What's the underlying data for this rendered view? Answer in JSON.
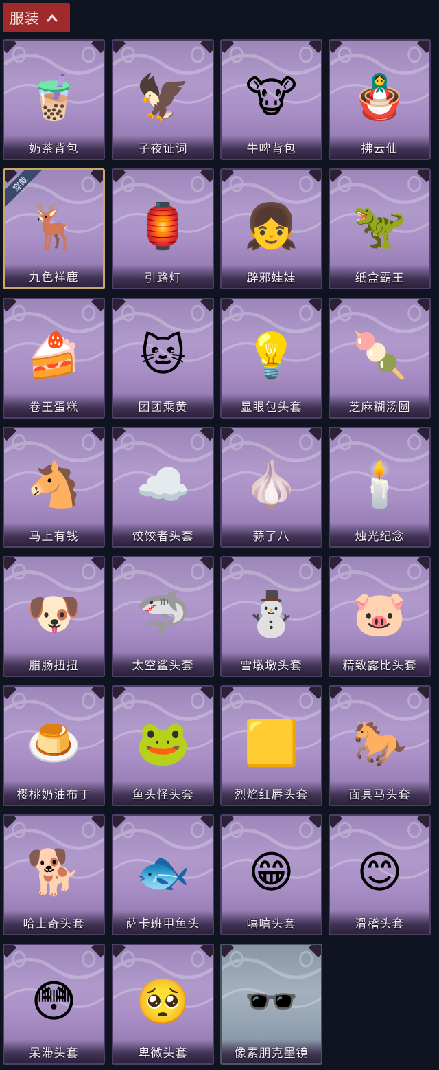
{
  "header": {
    "title": "服装"
  },
  "items": [
    {
      "label": "奶茶背包",
      "icon": "milk-tea-icon",
      "glyph": "🧋",
      "equipped": false,
      "style": "purple"
    },
    {
      "label": "子夜证词",
      "icon": "plague-doctor-icon",
      "glyph": "🦅",
      "equipped": false,
      "style": "purple"
    },
    {
      "label": "牛啤背包",
      "icon": "beer-barrel-icon",
      "glyph": "🐮",
      "equipped": false,
      "style": "purple"
    },
    {
      "label": "拂云仙",
      "icon": "cloud-fairy-charm-icon",
      "glyph": "🪆",
      "equipped": false,
      "style": "purple"
    },
    {
      "label": "九色祥鹿",
      "icon": "deer-charm-icon",
      "glyph": "🦌",
      "equipped": true,
      "badge": "穿戴",
      "style": "purple"
    },
    {
      "label": "引路灯",
      "icon": "lantern-icon",
      "glyph": "🏮",
      "equipped": false,
      "style": "purple"
    },
    {
      "label": "辟邪娃娃",
      "icon": "doll-head-icon",
      "glyph": "👧",
      "equipped": false,
      "style": "purple"
    },
    {
      "label": "纸盒霸王",
      "icon": "box-dinosaur-icon",
      "glyph": "🦖",
      "equipped": false,
      "style": "purple"
    },
    {
      "label": "卷王蛋糕",
      "icon": "roll-cake-icon",
      "glyph": "🍰",
      "equipped": false,
      "style": "purple"
    },
    {
      "label": "团团乘黄",
      "icon": "fluffy-cat-head-icon",
      "glyph": "🐱",
      "equipped": false,
      "style": "purple"
    },
    {
      "label": "显眼包头套",
      "icon": "lightbulb-head-icon",
      "glyph": "💡",
      "equipped": false,
      "style": "purple"
    },
    {
      "label": "芝麻糊汤圆",
      "icon": "dumpling-head-icon",
      "glyph": "🍡",
      "equipped": false,
      "style": "purple"
    },
    {
      "label": "马上有钱",
      "icon": "horse-head-icon",
      "glyph": "🐴",
      "equipped": false,
      "style": "purple"
    },
    {
      "label": "饺饺者头套",
      "icon": "cloud-head-icon",
      "glyph": "☁️",
      "equipped": false,
      "style": "purple"
    },
    {
      "label": "蒜了八",
      "icon": "garlic-head-icon",
      "glyph": "🧄",
      "equipped": false,
      "style": "purple"
    },
    {
      "label": "烛光纪念",
      "icon": "candle-head-icon",
      "glyph": "🕯️",
      "equipped": false,
      "style": "purple"
    },
    {
      "label": "腊肠扭扭",
      "icon": "dachshund-head-icon",
      "glyph": "🐶",
      "equipped": false,
      "style": "purple"
    },
    {
      "label": "太空鲨头套",
      "icon": "shark-head-icon",
      "glyph": "🦈",
      "equipped": false,
      "style": "purple"
    },
    {
      "label": "雪墩墩头套",
      "icon": "snowman-head-icon",
      "glyph": "⛄",
      "equipped": false,
      "style": "purple"
    },
    {
      "label": "精致露比头套",
      "icon": "pink-beaver-head-icon",
      "glyph": "🐷",
      "equipped": false,
      "style": "purple"
    },
    {
      "label": "樱桃奶油布丁",
      "icon": "pudding-head-icon",
      "glyph": "🍮",
      "equipped": false,
      "style": "purple"
    },
    {
      "label": "鱼头怪头套",
      "icon": "fish-head-icon",
      "glyph": "🐸",
      "equipped": false,
      "style": "purple"
    },
    {
      "label": "烈焰红唇头套",
      "icon": "pikachu-mask-icon",
      "glyph": "🟨",
      "equipped": false,
      "style": "purple"
    },
    {
      "label": "面具马头套",
      "icon": "horse-mask-icon",
      "glyph": "🐎",
      "equipped": false,
      "style": "purple"
    },
    {
      "label": "哈士奇头套",
      "icon": "husky-head-icon",
      "glyph": "🐕",
      "equipped": false,
      "style": "purple"
    },
    {
      "label": "萨卡班甲鱼头",
      "icon": "sacabambaspis-head-icon",
      "glyph": "🐟",
      "equipped": false,
      "style": "purple"
    },
    {
      "label": "嘻嘻头套",
      "icon": "grinning-face-head-icon",
      "glyph": "😁",
      "equipped": false,
      "style": "purple"
    },
    {
      "label": "滑稽头套",
      "icon": "funny-face-head-icon",
      "glyph": "😊",
      "equipped": false,
      "style": "purple"
    },
    {
      "label": "呆滞头套",
      "icon": "blank-stare-head-icon",
      "glyph": "😳",
      "equipped": false,
      "style": "purple"
    },
    {
      "label": "卑微头套",
      "icon": "humble-face-head-icon",
      "glyph": "🥺",
      "equipped": false,
      "style": "purple"
    },
    {
      "label": "像素朋克墨镜",
      "icon": "pixel-sunglasses-icon",
      "glyph": "🕶️",
      "equipped": false,
      "style": "gray"
    }
  ]
}
